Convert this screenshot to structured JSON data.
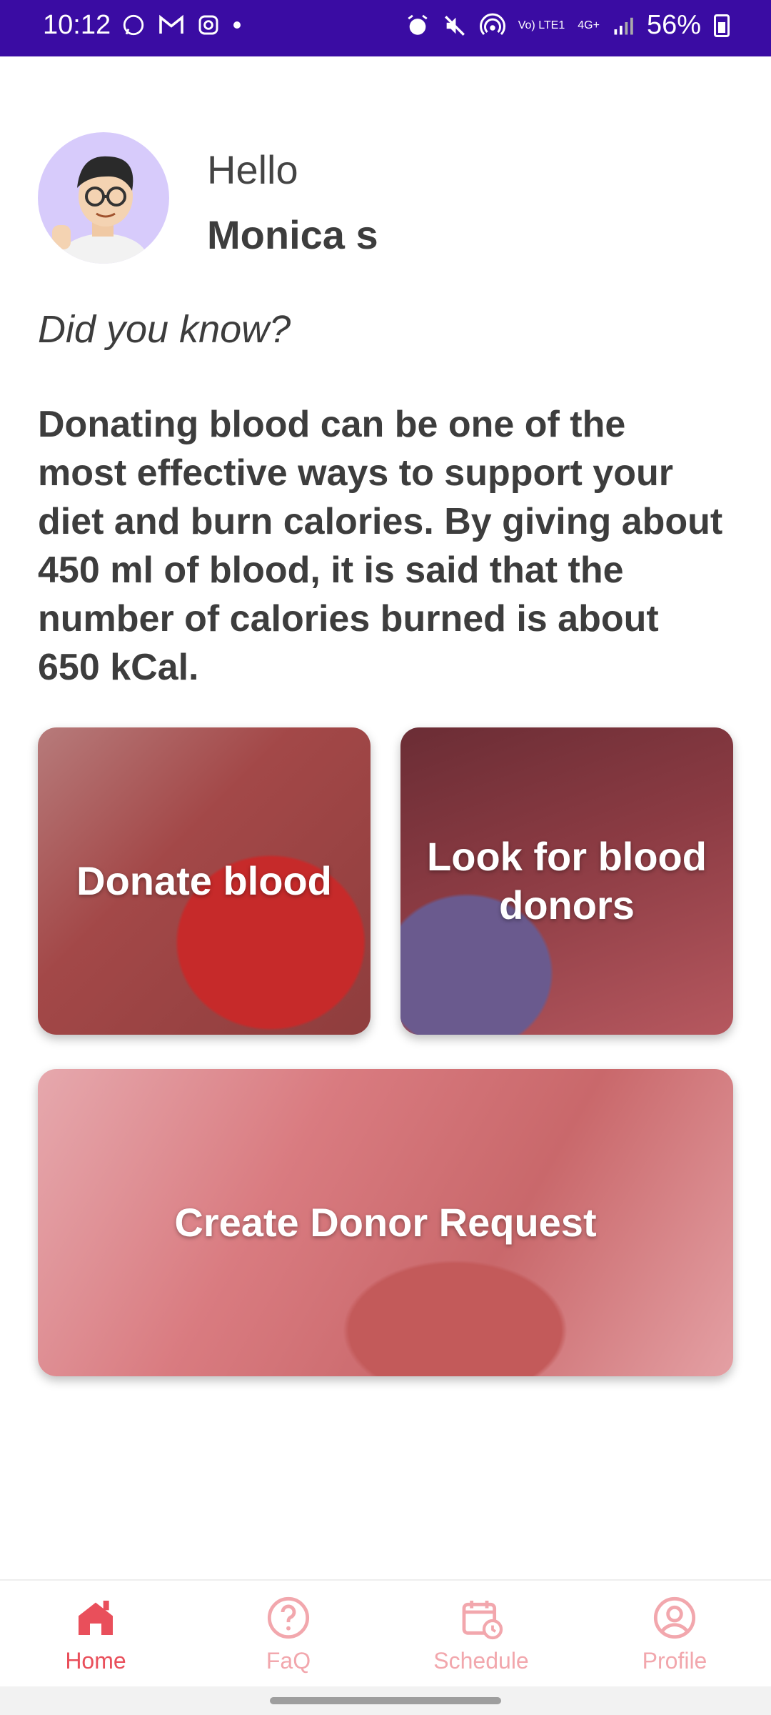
{
  "status_bar": {
    "time": "10:12",
    "network_volte": "Vo) LTE1",
    "network_4g": "4G+",
    "battery_percent": "56%",
    "icons": [
      "whatsapp-icon",
      "gmail-icon",
      "instagram-icon",
      "dot-icon",
      "alarm-icon",
      "mute-icon",
      "hotspot-icon",
      "signal-icon",
      "battery-icon"
    ]
  },
  "greeting": {
    "hello": "Hello",
    "name": "Monica s"
  },
  "did_you_know": "Did you know?",
  "fact": "Donating blood can be one of the most effective ways to support your diet and burn calories. By giving about 450 ml of blood, it is said that the number of calories burned is about 650 kCal.",
  "cards": {
    "donate": "Donate blood",
    "look": "Look for blood donors",
    "request": "Create Donor Request"
  },
  "bottom_nav": {
    "home": "Home",
    "faq": "FaQ",
    "schedule": "Schedule",
    "profile": "Profile"
  },
  "colors": {
    "status_bar": "#3a0ca3",
    "accent_active": "#e94f5b",
    "accent_inactive": "#f2a7ad",
    "text_dark": "#3d3d3d"
  }
}
